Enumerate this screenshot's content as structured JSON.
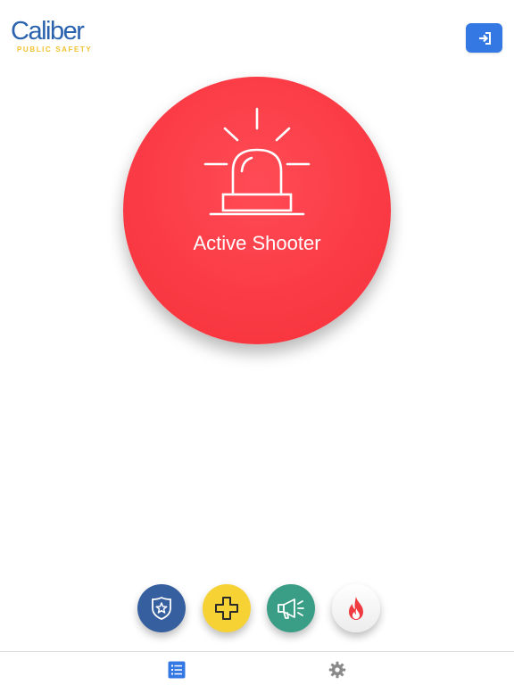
{
  "brand": {
    "name": "Caliber",
    "tagline": "PUBLIC SAFETY",
    "primary_color": "#2a62ae",
    "accent_color": "#f2c230"
  },
  "header": {
    "logout_icon": "sign-out-icon",
    "logout_color": "#3478e4"
  },
  "alert": {
    "label": "Active Shooter",
    "icon": "siren-icon",
    "color": "#fa3a44"
  },
  "quick_actions": [
    {
      "icon": "police-badge-icon",
      "color": "#365f9f"
    },
    {
      "icon": "medical-cross-icon",
      "color": "#f6d234"
    },
    {
      "icon": "megaphone-icon",
      "color": "#3a9d86"
    },
    {
      "icon": "fire-icon",
      "color": "#ffffff"
    }
  ],
  "tabbar": {
    "tabs": [
      {
        "icon": "list-icon",
        "active": true,
        "color": "#3478e4"
      },
      {
        "icon": "gear-icon",
        "active": false,
        "color": "#8a8a8a"
      }
    ]
  }
}
